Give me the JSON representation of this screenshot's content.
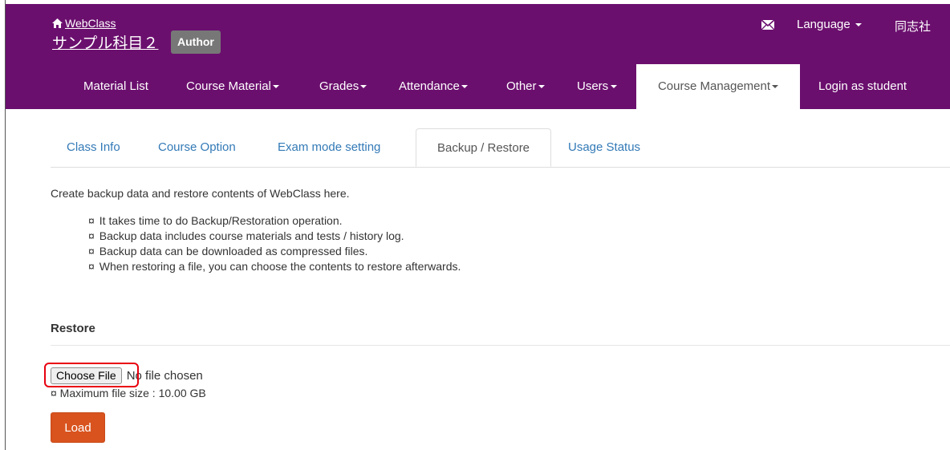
{
  "header": {
    "home_link": "WebClass",
    "course_title": "サンプル科目２",
    "role_badge": "Author",
    "mail_icon": "mail-icon",
    "language_label": "Language",
    "org_name": "同志社 ",
    "background_color": "#6b0f6e"
  },
  "nav": {
    "items": [
      {
        "label": "Material List"
      },
      {
        "label": "Course Material"
      },
      {
        "label": "Grades"
      },
      {
        "label": "Attendance"
      },
      {
        "label": "Other"
      },
      {
        "label": "Users"
      },
      {
        "label": "Course Management"
      },
      {
        "label": "Login as student"
      }
    ],
    "active": "Course Management"
  },
  "tabs": {
    "items": [
      {
        "label": "Class Info"
      },
      {
        "label": "Course Option"
      },
      {
        "label": "Exam mode setting"
      },
      {
        "label": "Backup / Restore"
      },
      {
        "label": "Usage Status"
      }
    ],
    "active": "Backup / Restore"
  },
  "content": {
    "intro": "Create backup data and restore contents of WebClass here.",
    "bullet_symbol": "¤",
    "notes": [
      "It takes time to do Backup/Restoration operation.",
      "Backup data includes course materials and tests / history log.",
      "Backup data can be downloaded as compressed files.",
      "When restoring a file, you can choose the contents to restore afterwards."
    ]
  },
  "restore": {
    "section_title": "Restore",
    "choose_file_label": "Choose File",
    "file_status": "No file chosen",
    "max_size": "¤ Maximum file size : 10.00 GB",
    "load_label": "Load",
    "load_color": "#d9531e",
    "highlight_color": "#e8000f"
  }
}
